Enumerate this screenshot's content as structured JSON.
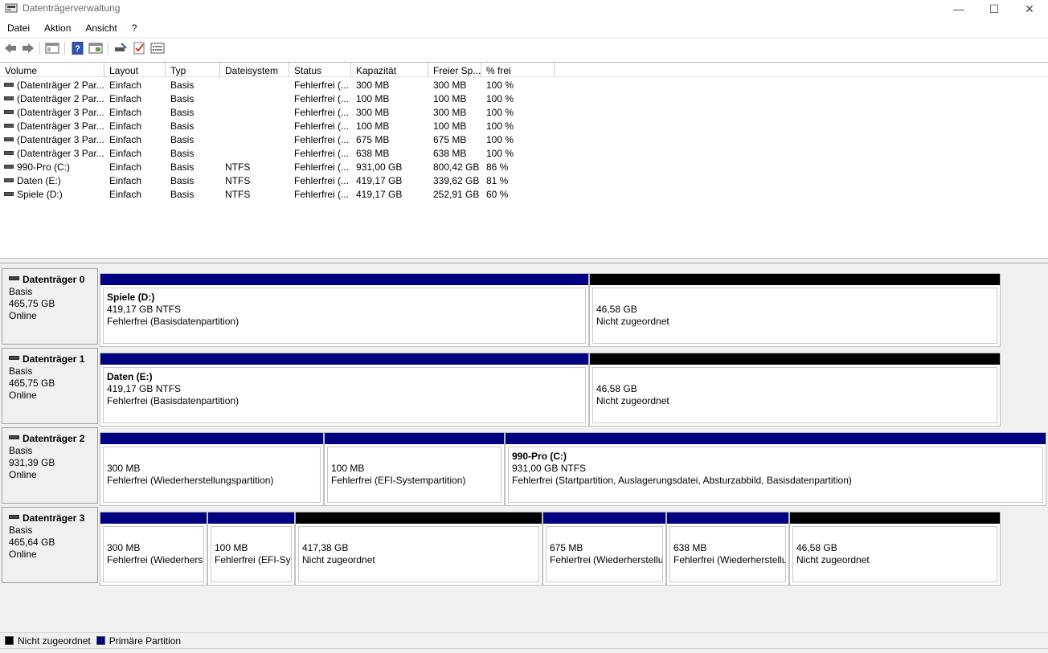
{
  "window": {
    "title": "Datenträgerverwaltung",
    "minimize": "—",
    "maximize": "☐",
    "close": "✕"
  },
  "menu": [
    "Datei",
    "Aktion",
    "Ansicht",
    "?"
  ],
  "toolbar": [
    "back-icon",
    "forward-icon",
    "console-tree-icon",
    "help-icon",
    "properties-icon",
    "connect-icon",
    "check-icon",
    "list-icon"
  ],
  "volume_list": {
    "columns": [
      "Volume",
      "Layout",
      "Typ",
      "Dateisystem",
      "Status",
      "Kapazität",
      "Freier Sp...",
      "% frei"
    ],
    "rows": [
      [
        "(Datenträger 2 Par...",
        "Einfach",
        "Basis",
        "",
        "Fehlerfrei (...",
        "300 MB",
        "300 MB",
        "100 %"
      ],
      [
        "(Datenträger 2 Par...",
        "Einfach",
        "Basis",
        "",
        "Fehlerfrei (...",
        "100 MB",
        "100 MB",
        "100 %"
      ],
      [
        "(Datenträger 3 Par...",
        "Einfach",
        "Basis",
        "",
        "Fehlerfrei (...",
        "300 MB",
        "300 MB",
        "100 %"
      ],
      [
        "(Datenträger 3 Par...",
        "Einfach",
        "Basis",
        "",
        "Fehlerfrei (...",
        "100 MB",
        "100 MB",
        "100 %"
      ],
      [
        "(Datenträger 3 Par...",
        "Einfach",
        "Basis",
        "",
        "Fehlerfrei (...",
        "675 MB",
        "675 MB",
        "100 %"
      ],
      [
        "(Datenträger 3 Par...",
        "Einfach",
        "Basis",
        "",
        "Fehlerfrei (...",
        "638 MB",
        "638 MB",
        "100 %"
      ],
      [
        "990-Pro (C:)",
        "Einfach",
        "Basis",
        "NTFS",
        "Fehlerfrei (...",
        "931,00 GB",
        "800,42 GB",
        "86 %"
      ],
      [
        "Daten (E:)",
        "Einfach",
        "Basis",
        "NTFS",
        "Fehlerfrei (...",
        "419,17 GB",
        "339,62 GB",
        "81 %"
      ],
      [
        "Spiele (D:)",
        "Einfach",
        "Basis",
        "NTFS",
        "Fehlerfrei (...",
        "419,17 GB",
        "252,91 GB",
        "60 %"
      ]
    ]
  },
  "disks": [
    {
      "name": "Datenträger 0",
      "type": "Basis",
      "size": "465,75 GB",
      "state": "Online",
      "partitions": [
        {
          "kind": "primary",
          "name": "Spiele  (D:)",
          "line1": "419,17 GB NTFS",
          "line2": "Fehlerfrei (Basisdatenpartition)"
        },
        {
          "kind": "unalloc",
          "name": "",
          "line1": "46,58 GB",
          "line2": "Nicht zugeordnet"
        }
      ]
    },
    {
      "name": "Datenträger 1",
      "type": "Basis",
      "size": "465,75 GB",
      "state": "Online",
      "partitions": [
        {
          "kind": "primary",
          "name": "Daten  (E:)",
          "line1": "419,17 GB NTFS",
          "line2": "Fehlerfrei (Basisdatenpartition)"
        },
        {
          "kind": "unalloc",
          "name": "",
          "line1": "46,58 GB",
          "line2": "Nicht zugeordnet"
        }
      ]
    },
    {
      "name": "Datenträger 2",
      "type": "Basis",
      "size": "931,39 GB",
      "state": "Online",
      "partitions": [
        {
          "kind": "primary",
          "name": "",
          "line1": "300 MB",
          "line2": "Fehlerfrei (Wiederherstellungspartition)"
        },
        {
          "kind": "primary",
          "name": "",
          "line1": "100 MB",
          "line2": "Fehlerfrei (EFI-Systempartition)"
        },
        {
          "kind": "primary",
          "name": "990-Pro  (C:)",
          "line1": "931,00 GB NTFS",
          "line2": "Fehlerfrei (Startpartition, Auslagerungsdatei, Absturzabbild, Basisdatenpartition)"
        }
      ]
    },
    {
      "name": "Datenträger 3",
      "type": "Basis",
      "size": "465,64 GB",
      "state": "Online",
      "partitions": [
        {
          "kind": "primary",
          "name": "",
          "line1": "300 MB",
          "line2": "Fehlerfrei (Wiederherst"
        },
        {
          "kind": "primary",
          "name": "",
          "line1": "100 MB",
          "line2": "Fehlerfrei (EFI-Sys"
        },
        {
          "kind": "unalloc",
          "name": "",
          "line1": "417,38 GB",
          "line2": "Nicht zugeordnet"
        },
        {
          "kind": "primary",
          "name": "",
          "line1": "675 MB",
          "line2": "Fehlerfrei (Wiederherstellu"
        },
        {
          "kind": "primary",
          "name": "",
          "line1": "638 MB",
          "line2": "Fehlerfrei (Wiederherstellu"
        },
        {
          "kind": "unalloc",
          "name": "",
          "line1": "46,58 GB",
          "line2": "Nicht zugeordnet"
        }
      ]
    }
  ],
  "legend": [
    {
      "label": "Nicht zugeordnet",
      "color": "#000000"
    },
    {
      "label": "Primäre Partition",
      "color": "#000080"
    }
  ],
  "colors": {
    "primary": "#000080",
    "unallocated": "#000000"
  }
}
